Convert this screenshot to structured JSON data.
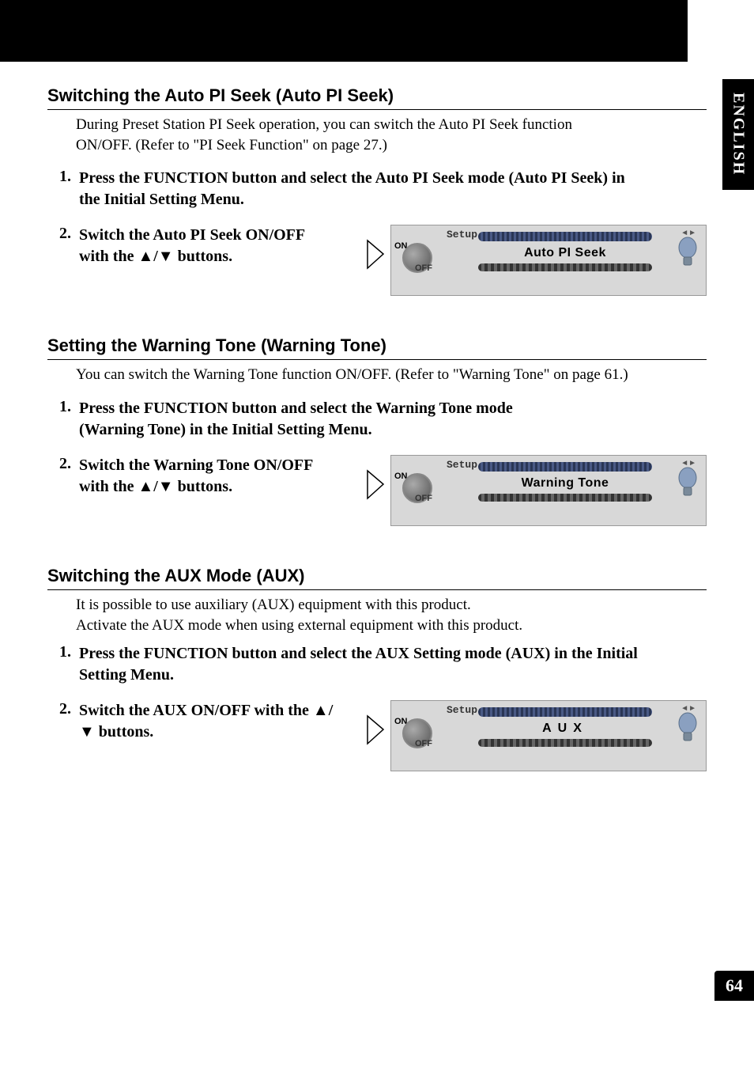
{
  "sideTab": "ENGLISH",
  "pageNumber": "64",
  "section1": {
    "heading": "Switching the Auto PI Seek (Auto PI Seek)",
    "desc": "During Preset Station PI Seek operation, you can switch the Auto PI Seek function ON/OFF. (Refer to \"PI Seek Function\" on page 27.)",
    "step1Num": "1.",
    "step1Text": "Press the FUNCTION button and select the Auto PI Seek mode (Auto PI Seek) in the Initial Setting Menu.",
    "step2Num": "2.",
    "step2Text": "Switch the Auto PI Seek ON/OFF with the ▲/▼ buttons.",
    "screen": {
      "setup": "Setup",
      "on": "ON",
      "off": "OFF",
      "mode": "Auto PI Seek"
    }
  },
  "section2": {
    "heading": "Setting the Warning Tone (Warning Tone)",
    "desc": "You can switch the Warning Tone function ON/OFF. (Refer to \"Warning Tone\" on page 61.)",
    "step1Num": "1.",
    "step1Text": "Press the FUNCTION button and select the Warning Tone mode (Warning Tone) in the Initial Setting Menu.",
    "step2Num": "2.",
    "step2Text": "Switch the Warning Tone ON/OFF with the ▲/▼ buttons.",
    "screen": {
      "setup": "Setup",
      "on": "ON",
      "off": "OFF",
      "mode": "Warning Tone"
    }
  },
  "section3": {
    "heading": "Switching the AUX Mode (AUX)",
    "desc1": "It is possible to use auxiliary (AUX) equipment with this product.",
    "desc2": "Activate the AUX mode when using external equipment with this product.",
    "step1Num": "1.",
    "step1Text": "Press the FUNCTION button and select the AUX Setting mode (AUX) in the Initial Setting Menu.",
    "step2Num": "2.",
    "step2Text": "Switch the AUX ON/OFF with the ▲/▼ buttons.",
    "screen": {
      "setup": "Setup",
      "on": "ON",
      "off": "OFF",
      "mode": "AUX"
    }
  }
}
